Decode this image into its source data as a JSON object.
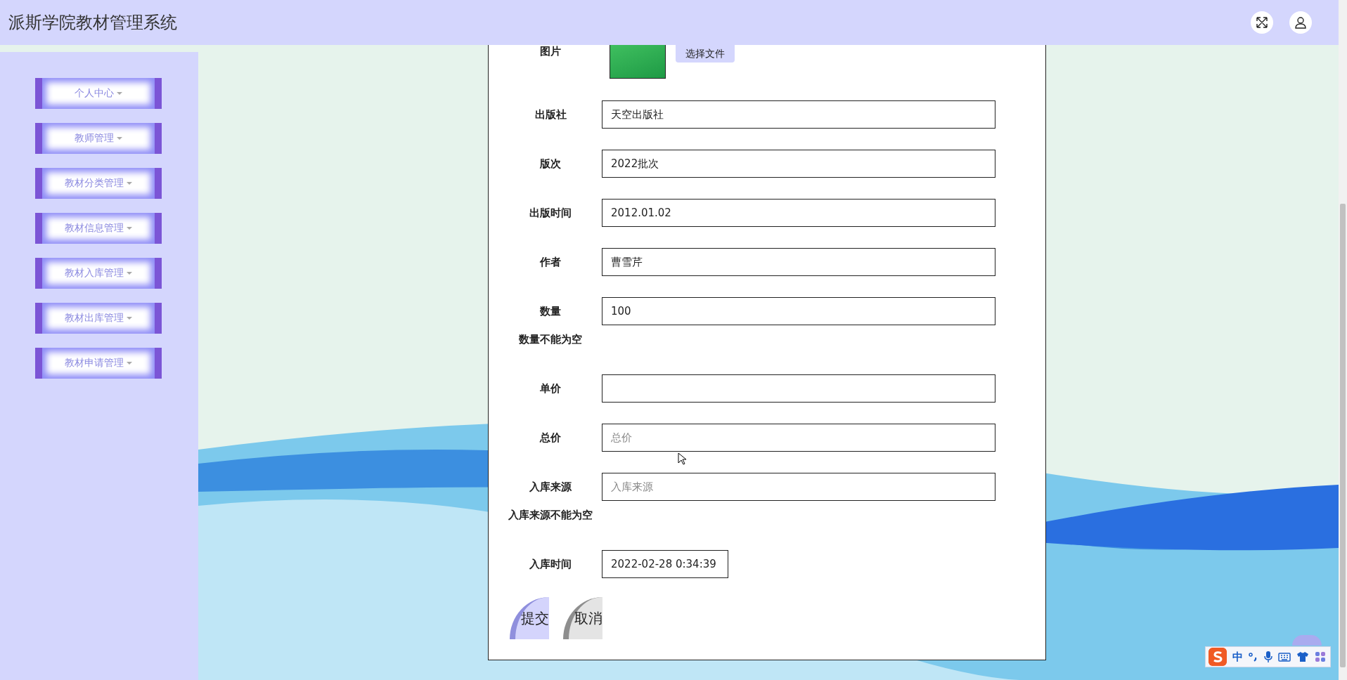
{
  "header": {
    "title": "派斯学院教材管理系统"
  },
  "sidebar": {
    "items": [
      {
        "label": "个人中心"
      },
      {
        "label": "教师管理"
      },
      {
        "label": "教材分类管理"
      },
      {
        "label": "教材信息管理"
      },
      {
        "label": "教材入库管理"
      },
      {
        "label": "教材出库管理"
      },
      {
        "label": "教材申请管理"
      }
    ]
  },
  "form": {
    "fields": [
      {
        "kind": "image",
        "label": "图片",
        "button": "选择文件"
      },
      {
        "kind": "text",
        "label": "出版社",
        "value": "天空出版社"
      },
      {
        "kind": "text",
        "label": "版次",
        "value": "2022批次"
      },
      {
        "kind": "text",
        "label": "出版时间",
        "value": "2012.01.02"
      },
      {
        "kind": "text",
        "label": "作者",
        "value": "曹雪芹"
      },
      {
        "kind": "text",
        "label": "数量",
        "value": "100",
        "error": "数量不能为空"
      },
      {
        "kind": "text",
        "label": "单价"
      },
      {
        "kind": "text",
        "label": "总价",
        "placeholder": "总价"
      },
      {
        "kind": "text",
        "label": "入库来源",
        "placeholder": "入库来源",
        "error": "入库来源不能为空"
      },
      {
        "kind": "short",
        "label": "入库时间",
        "value": "2022-02-28 0:34:39"
      }
    ],
    "buttons": [
      {
        "kind": "primary",
        "label": "提交"
      },
      {
        "kind": "secondary",
        "label": "取消"
      }
    ]
  },
  "ime_toolbar": {
    "mode": "中"
  }
}
